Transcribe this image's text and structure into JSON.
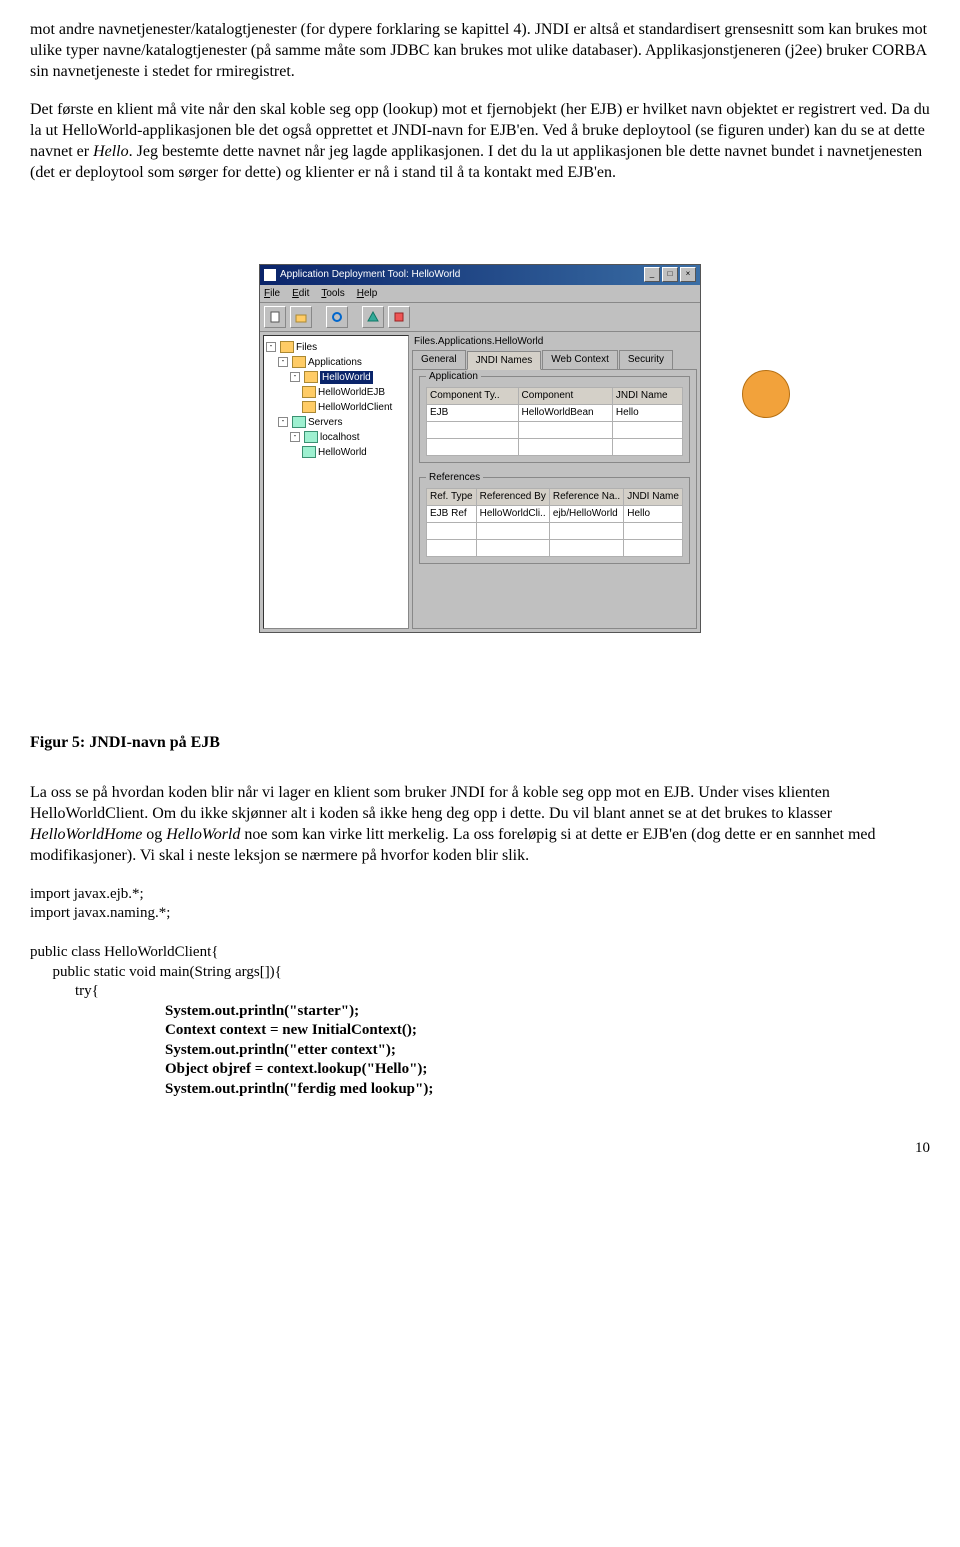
{
  "para1": "mot andre navnetjenester/katalogtjenester (for dypere forklaring se kapittel 4). JNDI er altså et standardisert grensesnitt som kan brukes mot ulike typer navne/katalogtjenester (på samme måte som JDBC kan brukes mot ulike databaser). Applikasjonstjeneren (j2ee) bruker CORBA sin navnetjeneste i stedet for rmiregistret.",
  "para2_a": "Det første en klient må vite når den skal koble seg opp (lookup) mot et fjernobjekt (her EJB) er hvilket navn objektet er registrert ved. Da du la ut HelloWorld-applikasjonen ble det også opprettet et JNDI-navn for EJB'en. Ved å bruke deploytool (se figuren under) kan du se at dette navnet er ",
  "para2_hello": "Hello",
  "para2_b": ". Jeg bestemte dette navnet når jeg lagde applikasjonen. I det du la ut applikasjonen ble dette navnet bundet i navnetjenesten (det er deploytool som sørger for dette) og klienter er nå i stand til å ta kontakt med EJB'en.",
  "deploytool": {
    "title": "Application Deployment Tool: HelloWorld",
    "menu": {
      "file": "File",
      "edit": "Edit",
      "tools": "Tools",
      "help": "Help"
    },
    "tree": {
      "files": "Files",
      "applications": "Applications",
      "helloworld": "HelloWorld",
      "ejb": "HelloWorldEJB",
      "client": "HelloWorldClient",
      "servers": "Servers",
      "localhost": "localhost",
      "hw2": "HelloWorld"
    },
    "breadcrumb": "Files.Applications.HelloWorld",
    "tabs": {
      "general": "General",
      "jndi": "JNDI Names",
      "web": "Web Context",
      "security": "Security"
    },
    "group_app": "Application",
    "app_headers": {
      "c1": "Component Ty..",
      "c2": "Component",
      "c3": "JNDI Name"
    },
    "app_row": {
      "c1": "EJB",
      "c2": "HelloWorldBean",
      "c3": "Hello"
    },
    "group_ref": "References",
    "ref_headers": {
      "c1": "Ref. Type",
      "c2": "Referenced By",
      "c3": "Reference Na..",
      "c4": "JNDI Name"
    },
    "ref_row": {
      "c1": "EJB Ref",
      "c2": "HelloWorldCli..",
      "c3": "ejb/HelloWorld",
      "c4": "Hello"
    }
  },
  "fig_caption": "Figur 5: JNDI-navn på EJB",
  "para3_a": "La oss se på hvordan koden blir når vi lager en klient som bruker JNDI for å koble seg opp mot en EJB. Under vises klienten HelloWorldClient. Om du ikke skjønner alt i koden så ikke heng deg opp i dette. Du vil blant annet se at det brukes to klasser ",
  "para3_hwh": "HelloWorldHome",
  "para3_and": " og ",
  "para3_hw": "HelloWorld",
  "para3_b": " noe som kan virke litt merkelig. La oss foreløpig si at dette er EJB'en (dog dette er en sannhet med modifikasjoner). Vi skal i neste leksjon se nærmere på hvorfor koden blir slik.",
  "code": {
    "l1": "import javax.ejb.*;",
    "l2": "import javax.naming.*;",
    "l3": "public class HelloWorldClient{",
    "l4": "      public static void main(String args[]){",
    "l5": "            try{",
    "l6": "                                    System.out.println(\"starter\");",
    "l7": "                                    Context context = new InitialContext();",
    "l8": "                                    System.out.println(\"etter context\");",
    "l9": "                                    Object objref = context.lookup(\"Hello\");",
    "l10": "                                    System.out.println(\"ferdig med lookup\");"
  },
  "page_number": "10"
}
